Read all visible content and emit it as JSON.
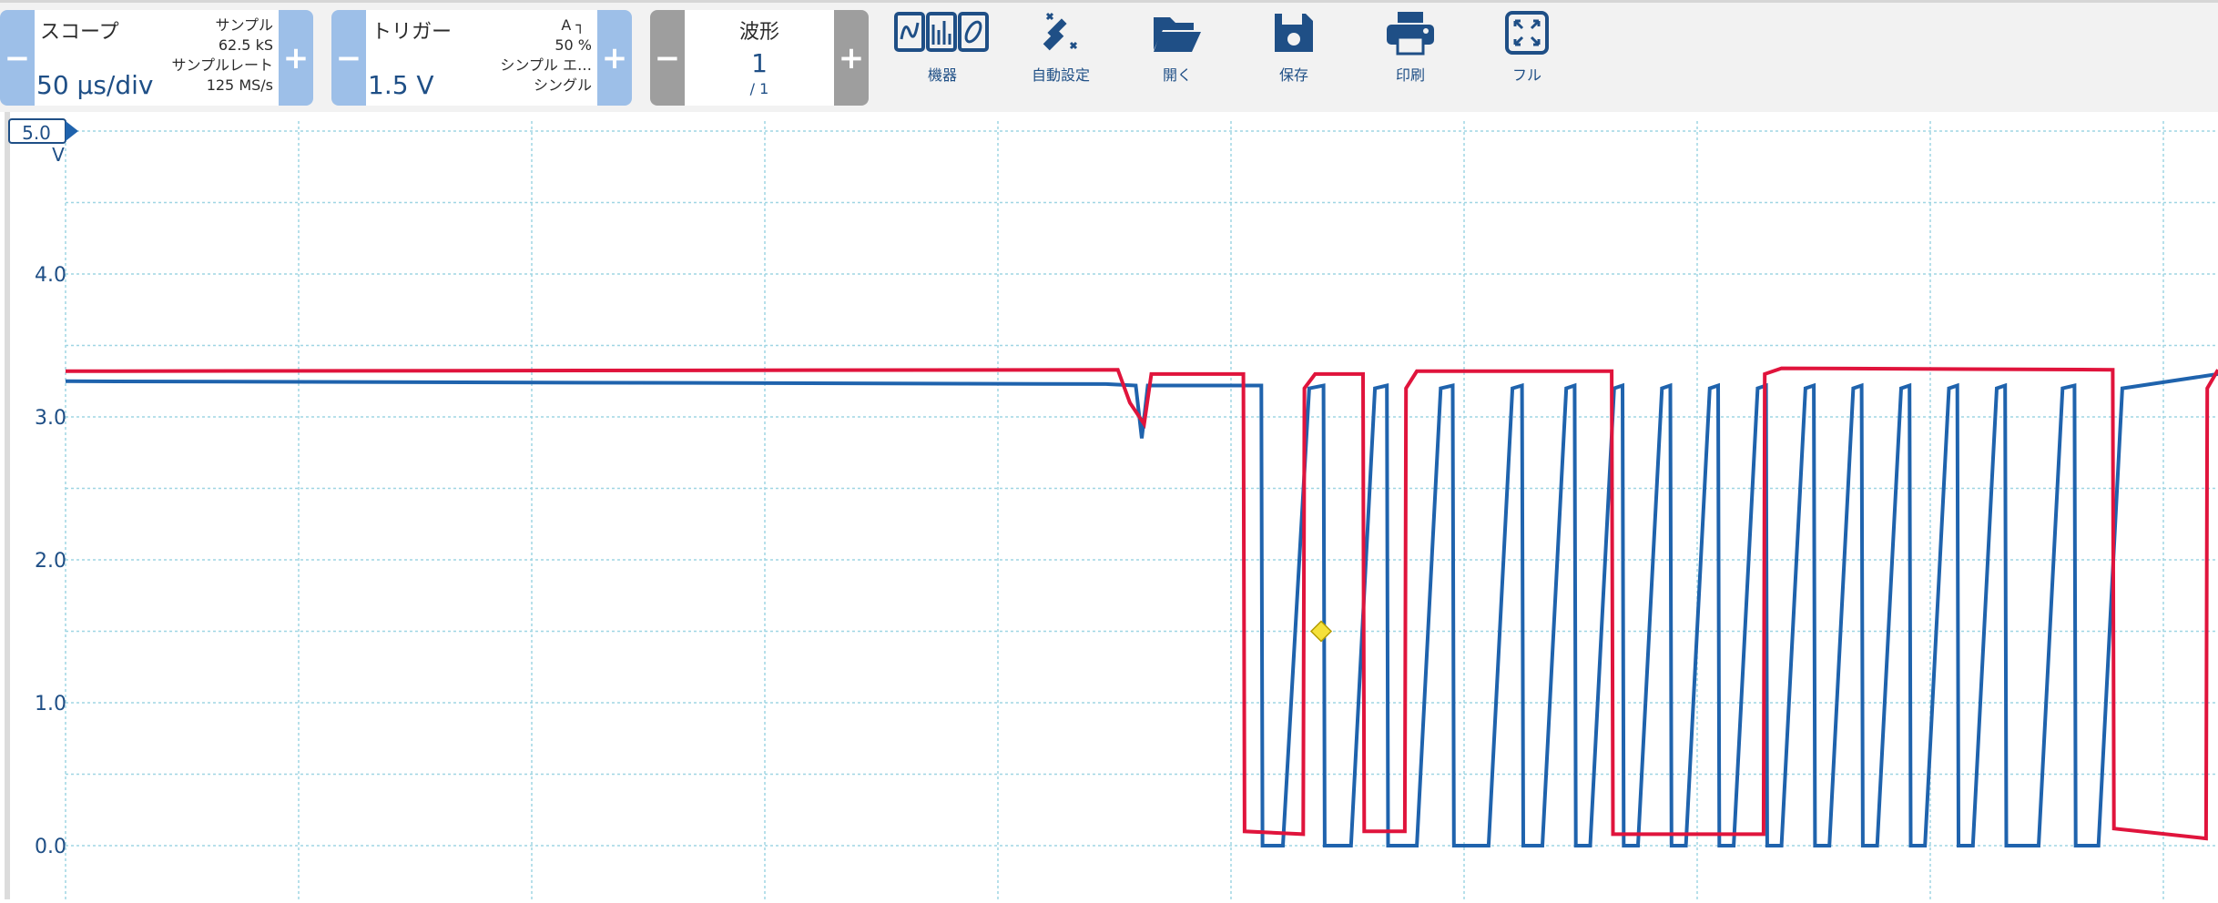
{
  "toolbar": {
    "scope": {
      "title": "スコープ",
      "value": "50 µs/div",
      "samples_label": "サンプル",
      "samples": "62.5 kS",
      "rate_label": "サンプルレート",
      "rate": "125 MS/s"
    },
    "trigger": {
      "title": "トリガー",
      "value": "1.5 V",
      "channel": "A",
      "percent": "50 %",
      "type": "シンプル エ…",
      "mode": "シングル"
    },
    "waveform": {
      "title": "波形",
      "value": "1",
      "total": "/ 1"
    },
    "tools": [
      {
        "label": "機器",
        "icon": "instrument-icon"
      },
      {
        "label": "自動設定",
        "icon": "auto-setup-icon"
      },
      {
        "label": "開く",
        "icon": "folder-open-icon"
      },
      {
        "label": "保存",
        "icon": "save-icon"
      },
      {
        "label": "印刷",
        "icon": "print-icon"
      },
      {
        "label": "フル",
        "icon": "fullscreen-icon"
      }
    ],
    "minus": "−",
    "plus": "+"
  },
  "chart_data": {
    "type": "line",
    "y_range": [
      0.0,
      5.0
    ],
    "ylabel": "V",
    "y_ticks": [
      "5.0",
      "4.0",
      "3.0",
      "2.0",
      "1.0",
      "0.0"
    ],
    "grid": true,
    "trigger_marker_volts": 1.5,
    "series": [
      {
        "name": "",
        "color": "#1f63ad",
        "points": [
          [
            0,
            3.25
          ],
          [
            870,
            3.23
          ],
          [
            895,
            3.22
          ],
          [
            900,
            2.85
          ],
          [
            905,
            3.22
          ],
          [
            1000,
            3.22
          ],
          [
            1001,
            0.0
          ],
          [
            1018,
            0.0
          ],
          [
            1040,
            3.2
          ],
          [
            1052,
            3.22
          ],
          [
            1053,
            0.0
          ],
          [
            1075,
            0.0
          ],
          [
            1095,
            3.2
          ],
          [
            1105,
            3.22
          ],
          [
            1106,
            0.0
          ],
          [
            1130,
            0.0
          ],
          [
            1150,
            3.2
          ],
          [
            1160,
            3.22
          ],
          [
            1161,
            0.0
          ],
          [
            1190,
            0.0
          ],
          [
            1210,
            3.2
          ],
          [
            1218,
            3.22
          ],
          [
            1219,
            0.0
          ],
          [
            1235,
            0.0
          ],
          [
            1255,
            3.2
          ],
          [
            1262,
            3.22
          ],
          [
            1263,
            0.0
          ],
          [
            1275,
            0.0
          ],
          [
            1295,
            3.2
          ],
          [
            1302,
            3.22
          ],
          [
            1303,
            0.0
          ],
          [
            1315,
            0.0
          ],
          [
            1335,
            3.2
          ],
          [
            1342,
            3.22
          ],
          [
            1343,
            0.0
          ],
          [
            1355,
            0.0
          ],
          [
            1375,
            3.2
          ],
          [
            1382,
            3.22
          ],
          [
            1383,
            0.0
          ],
          [
            1395,
            0.0
          ],
          [
            1415,
            3.2
          ],
          [
            1422,
            3.22
          ],
          [
            1423,
            0.0
          ],
          [
            1435,
            0.0
          ],
          [
            1455,
            3.2
          ],
          [
            1462,
            3.22
          ],
          [
            1463,
            0.0
          ],
          [
            1475,
            0.0
          ],
          [
            1495,
            3.2
          ],
          [
            1502,
            3.22
          ],
          [
            1503,
            0.0
          ],
          [
            1515,
            0.0
          ],
          [
            1535,
            3.2
          ],
          [
            1542,
            3.22
          ],
          [
            1543,
            0.0
          ],
          [
            1555,
            0.0
          ],
          [
            1575,
            3.2
          ],
          [
            1582,
            3.22
          ],
          [
            1583,
            0.0
          ],
          [
            1595,
            0.0
          ],
          [
            1615,
            3.2
          ],
          [
            1622,
            3.22
          ],
          [
            1623,
            0.0
          ],
          [
            1650,
            0.0
          ],
          [
            1670,
            3.2
          ],
          [
            1680,
            3.22
          ],
          [
            1681,
            0.0
          ],
          [
            1700,
            0.0
          ],
          [
            1720,
            3.2
          ],
          [
            1800,
            3.3
          ]
        ]
      },
      {
        "name": "",
        "color": "#e0143c",
        "points": [
          [
            0,
            3.32
          ],
          [
            880,
            3.33
          ],
          [
            890,
            3.1
          ],
          [
            902,
            2.95
          ],
          [
            908,
            3.3
          ],
          [
            985,
            3.3
          ],
          [
            986,
            0.1
          ],
          [
            1035,
            0.08
          ],
          [
            1036,
            3.2
          ],
          [
            1045,
            3.3
          ],
          [
            1085,
            3.3
          ],
          [
            1086,
            0.1
          ],
          [
            1120,
            0.1
          ],
          [
            1121,
            3.2
          ],
          [
            1130,
            3.32
          ],
          [
            1293,
            3.32
          ],
          [
            1294,
            0.08
          ],
          [
            1420,
            0.08
          ],
          [
            1421,
            3.3
          ],
          [
            1435,
            3.34
          ],
          [
            1712,
            3.33
          ],
          [
            1713,
            0.12
          ],
          [
            1790,
            0.05
          ],
          [
            1791,
            3.2
          ],
          [
            1800,
            3.33
          ]
        ]
      }
    ]
  }
}
